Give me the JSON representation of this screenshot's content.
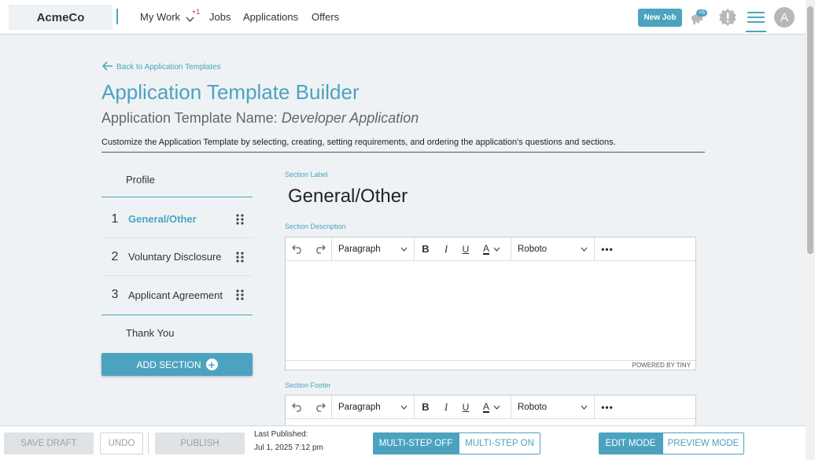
{
  "header": {
    "logo": "AcmeCo",
    "nav": [
      {
        "label": "My Work",
        "badge": "+1"
      },
      {
        "label": "Jobs"
      },
      {
        "label": "Applications"
      },
      {
        "label": "Offers"
      }
    ],
    "new_job": "New Job",
    "notification_count": "+5",
    "avatar_initial": "A"
  },
  "page": {
    "back_link": "Back to Application Templates",
    "title": "Application Template Builder",
    "template_name_label": "Application Template Name:",
    "template_name": "Developer Application",
    "description": "Customize the Application Template by selecting, creating, setting requirements, and ordering the application's questions and sections."
  },
  "sections": {
    "profile": "Profile",
    "items": [
      {
        "num": "1",
        "label": "General/Other",
        "active": true
      },
      {
        "num": "2",
        "label": "Voluntary Disclosure",
        "active": false
      },
      {
        "num": "3",
        "label": "Applicant Agreement",
        "active": false
      }
    ],
    "thank_you": "Thank You",
    "add_section": "ADD SECTION"
  },
  "editor": {
    "section_label_caption": "Section Label",
    "section_label_value": "General/Other",
    "section_description_caption": "Section Description",
    "section_footer_caption": "Section Footer",
    "block_format": "Paragraph",
    "font_family": "Roboto",
    "powered_by": "POWERED BY TINY"
  },
  "footer": {
    "save_draft": "SAVE DRAFT",
    "undo": "UNDO",
    "publish": "PUBLISH",
    "last_published_label": "Last Published:",
    "last_published_value": "Jul 1, 2025 7:12 pm",
    "multistep_off": "MULTI-STEP OFF",
    "multistep_on": "MULTI-STEP ON",
    "edit_mode": "EDIT MODE",
    "preview_mode": "PREVIEW MODE"
  },
  "colors": {
    "accent": "#4ca3bf",
    "background": "#eef2f5"
  }
}
